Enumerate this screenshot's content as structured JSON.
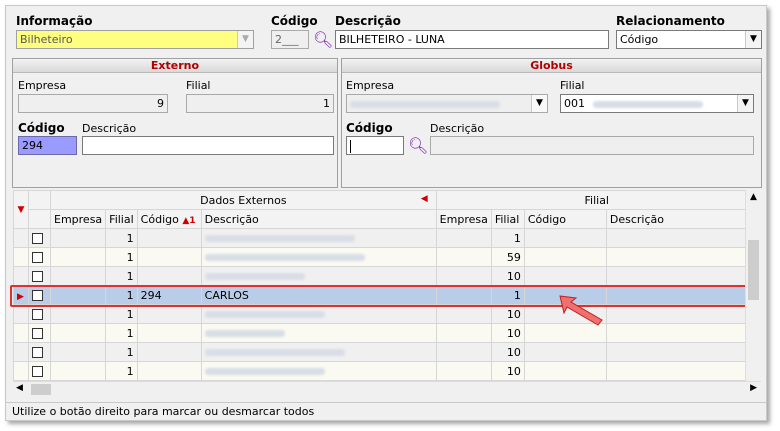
{
  "top": {
    "info_label": "Informação",
    "info_value": "Bilheteiro",
    "codigo_label": "Código",
    "codigo_value": "2___",
    "descricao_label": "Descrição",
    "descricao_value": "BILHETEIRO - LUNA",
    "relacionamento_label": "Relacionamento",
    "relacionamento_value": "Código"
  },
  "externo": {
    "title": "Externo",
    "empresa_label": "Empresa",
    "empresa_value": "9",
    "filial_label": "Filial",
    "filial_value": "1",
    "codigo_label": "Código",
    "codigo_value": "294",
    "descricao_label": "Descrição",
    "descricao_value": ""
  },
  "globus": {
    "title": "Globus",
    "empresa_label": "Empresa",
    "filial_label": "Filial",
    "filial_value": "001",
    "codigo_label": "Código",
    "descricao_label": "Descrição"
  },
  "grid": {
    "group_externos": "Dados Externos",
    "group_filial": "Filial",
    "columns": [
      "Empresa",
      "Filial",
      "Código",
      "Descrição",
      "Empresa",
      "Filial",
      "Código",
      "Descrição"
    ],
    "sort_indicator": "1",
    "rows": [
      {
        "filial": "1",
        "codigo": "",
        "descricao": "",
        "filial2": "1"
      },
      {
        "filial": "1",
        "codigo": "",
        "descricao": "",
        "filial2": "59"
      },
      {
        "filial": "1",
        "codigo": "",
        "descricao": "",
        "filial2": "10"
      },
      {
        "filial": "1",
        "codigo": "294",
        "descricao": "CARLOS",
        "filial2": "1"
      },
      {
        "filial": "1",
        "codigo": "",
        "descricao": "",
        "filial2": "10"
      },
      {
        "filial": "1",
        "codigo": "",
        "descricao": "",
        "filial2": "10"
      },
      {
        "filial": "1",
        "codigo": "",
        "descricao": "",
        "filial2": "10"
      },
      {
        "filial": "1",
        "codigo": "",
        "descricao": "",
        "filial2": "10"
      }
    ]
  },
  "status_text": "Utilize o botão direito para marcar ou desmarcar todos",
  "colors": {
    "highlight_border": "#e03030",
    "selected_row": "#b9cde8",
    "info_field": "#fefe80",
    "codigo_field": "#9a9aff"
  }
}
